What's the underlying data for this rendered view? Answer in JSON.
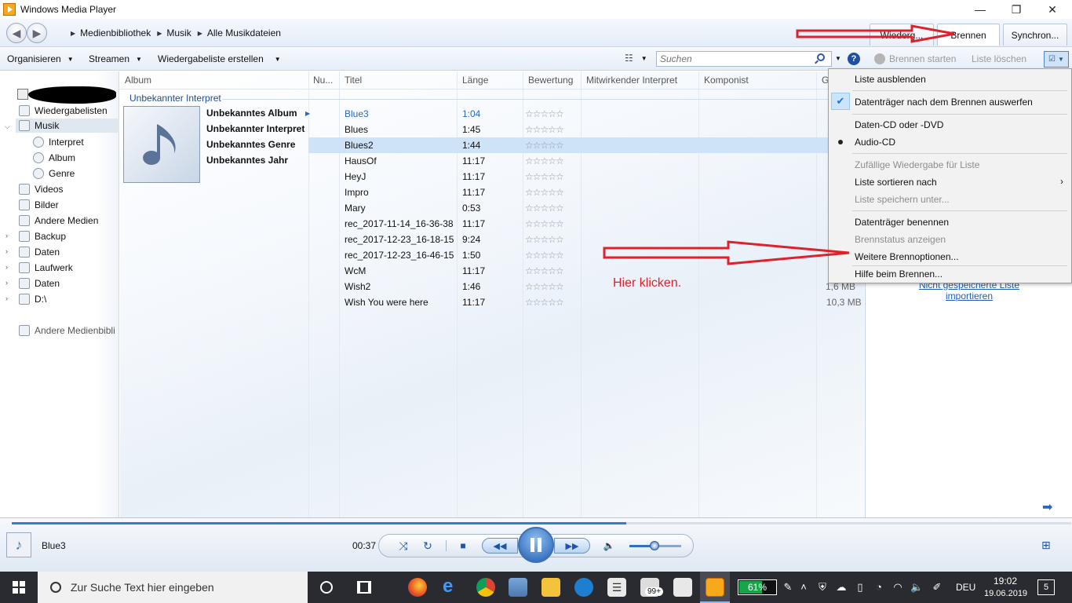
{
  "window": {
    "title": "Windows Media Player",
    "controls": {
      "minimize": "—",
      "restore": "❐",
      "close": "✕"
    }
  },
  "nav": {
    "back": "◀",
    "forward": "▶",
    "breadcrumb": [
      "Medienbibliothek",
      "Musik",
      "Alle Musikdateien"
    ],
    "tabs": {
      "play": "Wiederg...",
      "burn": "Brennen",
      "sync": "Synchron..."
    }
  },
  "toolbar": {
    "organize": "Organisieren",
    "stream": "Streamen",
    "create_playlist": "Wiedergabeliste erstellen",
    "search_placeholder": "Suchen",
    "help": "?",
    "start_burn": "Brennen starten",
    "clear_list": "Liste löschen"
  },
  "sidebar": {
    "items": [
      {
        "label": "Wiedergabelisten"
      },
      {
        "label": "Musik"
      },
      {
        "label": "Interpret"
      },
      {
        "label": "Album"
      },
      {
        "label": "Genre"
      },
      {
        "label": "Videos"
      },
      {
        "label": "Bilder"
      },
      {
        "label": "Andere Medien"
      },
      {
        "label": "Backup"
      },
      {
        "label": "Daten"
      },
      {
        "label": "Laufwerk"
      },
      {
        "label": "Daten"
      },
      {
        "label": "D:\\"
      },
      {
        "label": "Andere Medienbibli"
      }
    ]
  },
  "columns": [
    "Album",
    "Nu...",
    "Titel",
    "Länge",
    "Bewertung",
    "Mitwirkender Interpret",
    "Komponist",
    "G"
  ],
  "group": {
    "header": "Unbekannter Interpret",
    "album": "Unbekanntes Album",
    "artist": "Unbekannter Interpret",
    "genre": "Unbekanntes Genre",
    "year": "Unbekanntes Jahr"
  },
  "tracks": [
    {
      "title": "Blue3",
      "length": "1:04",
      "rating": "☆☆☆☆☆"
    },
    {
      "title": "Blues",
      "length": "1:45",
      "rating": "☆☆☆☆☆"
    },
    {
      "title": "Blues2",
      "length": "1:44",
      "rating": "☆☆☆☆☆"
    },
    {
      "title": "HausOf",
      "length": "11:17",
      "rating": "☆☆☆☆☆"
    },
    {
      "title": "HeyJ",
      "length": "11:17",
      "rating": "☆☆☆☆☆"
    },
    {
      "title": "Impro",
      "length": "11:17",
      "rating": "☆☆☆☆☆"
    },
    {
      "title": "Mary",
      "length": "0:53",
      "rating": "☆☆☆☆☆"
    },
    {
      "title": "rec_2017-11-14_16-36-38",
      "length": "11:17",
      "rating": "☆☆☆☆☆"
    },
    {
      "title": "rec_2017-12-23_16-18-15",
      "length": "9:24",
      "rating": "☆☆☆☆☆"
    },
    {
      "title": "rec_2017-12-23_16-46-15",
      "length": "1:50",
      "rating": "☆☆☆☆☆"
    },
    {
      "title": "WcM",
      "length": "11:17",
      "rating": "☆☆☆☆☆"
    },
    {
      "title": "Wish2",
      "length": "1:46",
      "rating": "☆☆☆☆☆"
    },
    {
      "title": "Wish You were here",
      "length": "11:17",
      "rating": "☆☆☆☆☆"
    }
  ],
  "right_pane": {
    "import_link_line1": "Nicht gespeicherte Liste",
    "import_link_line2": "importieren",
    "sizes": [
      "1,6 MB",
      "10,3 MB"
    ],
    "arrow": "➡"
  },
  "menu": {
    "hide_list": "Liste ausblenden",
    "eject_after_burn": "Datenträger nach dem Brennen auswerfen",
    "data_cd": "Daten-CD oder -DVD",
    "audio_cd": "Audio-CD",
    "shuffle": "Zufällige Wiedergabe für Liste",
    "sort_by": "Liste sortieren nach",
    "save_as": "Liste speichern unter...",
    "name_disc": "Datenträger benennen",
    "burn_status": "Brennstatus anzeigen",
    "more_options": "Weitere Brennoptionen...",
    "help_burning": "Hilfe beim Brennen...",
    "check": "✔",
    "submenu_arrow": "›"
  },
  "annotation": {
    "text": "Hier klicken."
  },
  "player": {
    "now_playing": "Blue3",
    "time": "00:37",
    "progress": 0.58,
    "volume": 0.45,
    "shuffle": "⤨",
    "repeat": "↻",
    "stop": "■",
    "prev": "◀◀",
    "next": "▶▶",
    "volume_icon": "🔈",
    "switch_view": "⊞"
  },
  "taskbar": {
    "search_placeholder": "Zur Suche Text hier eingeben",
    "battery": "61%",
    "badge": "99+",
    "language": "DEU",
    "time": "19:02",
    "date": "19.06.2019",
    "notifications": "5"
  }
}
